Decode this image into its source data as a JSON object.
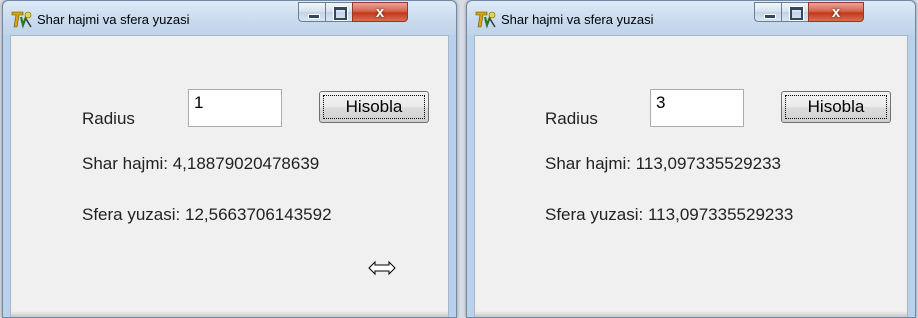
{
  "windows": [
    {
      "title": "Shar hajmi va sfera yuzasi",
      "controls": {
        "minimize": "minimize",
        "maximize": "maximize",
        "close": "x"
      },
      "radius_label": "Radius",
      "radius_value": "1",
      "button_label": "Hisobla",
      "volume_text": "Shar hajmi: 4,18879020478639",
      "area_text": "Sfera yuzasi: 12,5663706143592",
      "cursor_icon": "resize-horizontal-icon"
    },
    {
      "title": "Shar hajmi va sfera yuzasi",
      "controls": {
        "minimize": "minimize",
        "maximize": "maximize",
        "close": "x"
      },
      "radius_label": "Radius",
      "radius_value": "3",
      "button_label": "Hisobla",
      "volume_text": "Shar hajmi: 113,097335529233",
      "area_text": "Sfera yuzasi: 113,097335529233"
    }
  ],
  "colors": {
    "titlebar": "#c9dbee",
    "client": "#f0f0f0",
    "close_button": "#c3381c"
  }
}
